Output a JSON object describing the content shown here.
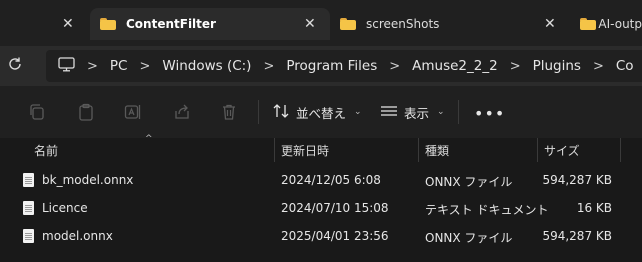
{
  "tabs": [
    {
      "label": "ContentFilter",
      "active": true
    },
    {
      "label": "screenShots",
      "active": false
    },
    {
      "label": "AI-outp",
      "active": false
    }
  ],
  "address": {
    "root_icon": "computer-icon",
    "crumbs": [
      "PC",
      "Windows (C:)",
      "Program Files",
      "Amuse2_2_2",
      "Plugins",
      "Co"
    ]
  },
  "toolbar": {
    "sort_label": "並べ替え",
    "view_label": "表示"
  },
  "columns": {
    "name": "名前",
    "modified": "更新日時",
    "type": "種類",
    "size": "サイズ"
  },
  "files": [
    {
      "name": "bk_model.onnx",
      "modified": "2024/12/05 6:08",
      "type": "ONNX ファイル",
      "size": "594,287 KB"
    },
    {
      "name": "Licence",
      "modified": "2024/07/10 15:08",
      "type": "テキスト ドキュメント",
      "size": "16 KB"
    },
    {
      "name": "model.onnx",
      "modified": "2025/04/01 23:56",
      "type": "ONNX ファイル",
      "size": "594,287 KB"
    }
  ],
  "colors": {
    "background": "#191919",
    "folder_yellow": "#f5c447",
    "active_tab": "#2b2b2b"
  }
}
